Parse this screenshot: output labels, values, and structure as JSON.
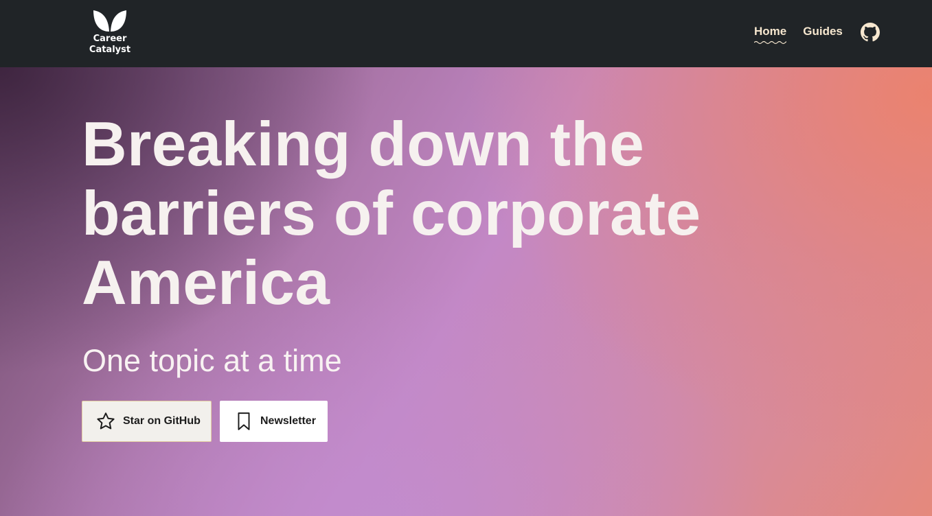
{
  "header": {
    "logo_text": "Career\nCatalyst",
    "nav": [
      {
        "label": "Home",
        "active": true
      },
      {
        "label": "Guides",
        "active": false
      }
    ],
    "github_icon": "github-icon"
  },
  "hero": {
    "headline": "Breaking down the barriers of corporate America",
    "tagline": "One topic at a time",
    "buttons": [
      {
        "label": "Star on GitHub",
        "icon": "star-icon"
      },
      {
        "label": "Newsletter",
        "icon": "bookmark-icon"
      }
    ]
  },
  "colors": {
    "header_bg": "#202427",
    "nav_text": "#f6e7cf",
    "hero_gradient": [
      "#4b3048",
      "#c388c6",
      "#e5897c"
    ],
    "star_button_bg": "#f2f0ec",
    "newsletter_button_bg": "#ffffff"
  }
}
